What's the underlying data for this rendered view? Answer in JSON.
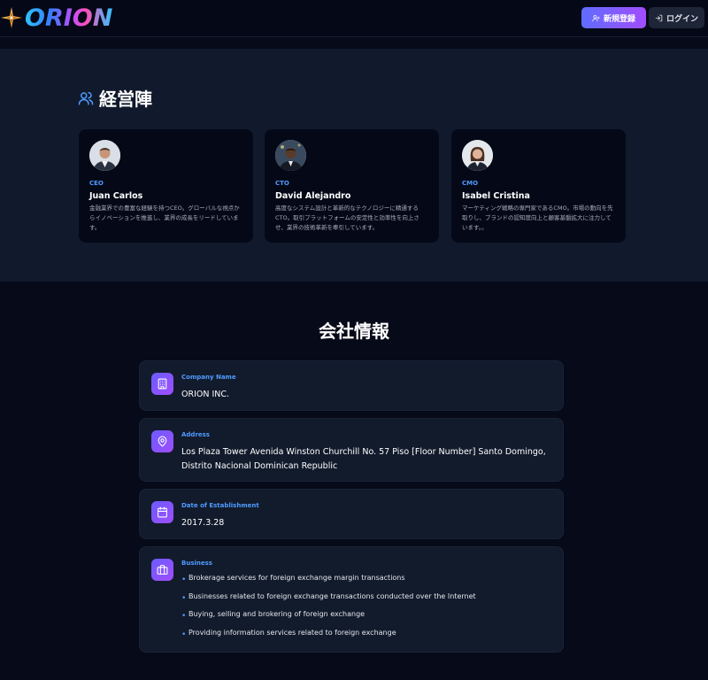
{
  "header": {
    "logo_text": "ORION",
    "signup_label": "新規登録",
    "login_label": "ログイン"
  },
  "executives": {
    "title": "経営陣",
    "members": [
      {
        "role": "CEO",
        "name": "Juan Carlos",
        "description": "金融業界での豊富な経験を持つCEO。グローバルな視点からイノベーションを推進し、業界の成長をリードしています。"
      },
      {
        "role": "CTO",
        "name": "David Alejandro",
        "description": "高度なシステム設計と革新的なテクノロジーに精通するCTO。取引プラットフォームの安定性と効率性を向上させ、業界の技術革新を牽引しています。"
      },
      {
        "role": "CMO",
        "name": "Isabel Cristina",
        "description": "マーケティング戦略の専門家であるCMO。市場の動向を先取りし、ブランドの認知度向上と顧客基盤拡大に注力しています。。"
      }
    ]
  },
  "company": {
    "title": "会社情報",
    "name_label": "Company Name",
    "name_value": "ORION INC.",
    "address_label": "Address",
    "address_value": "Los Plaza Tower Avenida Winston Churchill No. 57 Piso [Floor Number] Santo Domingo, Distrito Nacional Dominican Republic",
    "date_label": "Date of Establishment",
    "date_value": "2017.3.28",
    "business_label": "Business",
    "business_items": [
      "Brokerage services for foreign exchange margin transactions",
      "Businesses related to foreign exchange transactions conducted over the Internet",
      "Buying, selling and brokering of foreign exchange",
      "Providing information services related to foreign exchange"
    ]
  },
  "colors": {
    "accent_blue": "#4f9bff",
    "gradient_start": "#5f6cff",
    "gradient_end": "#a24dff",
    "page_bg": "#060a19",
    "section_bg": "#111a2c"
  }
}
